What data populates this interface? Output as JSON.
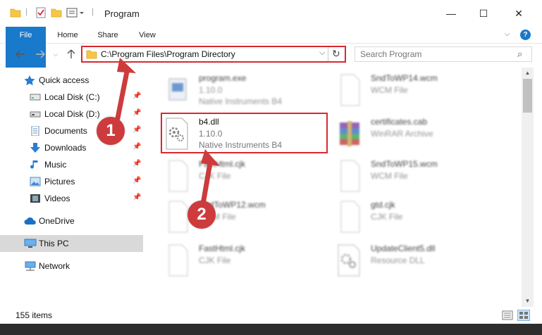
{
  "window": {
    "title": "Program",
    "controls": {
      "minimize": "—",
      "maximize": "☐",
      "close": "✕"
    }
  },
  "ribbon": {
    "tabs": [
      "File",
      "Home",
      "Share",
      "View"
    ],
    "help": "?"
  },
  "address": {
    "path": "C:\\Program Files\\Program Directory"
  },
  "search": {
    "placeholder": "Search Program"
  },
  "nav": {
    "quick_access": "Quick access",
    "items": [
      {
        "label": "Local Disk (C:)",
        "icon": "drive-icon"
      },
      {
        "label": "Local Disk (D:)",
        "icon": "drive-icon"
      },
      {
        "label": "Documents",
        "icon": "documents-icon"
      },
      {
        "label": "Downloads",
        "icon": "downloads-icon"
      },
      {
        "label": "Music",
        "icon": "music-icon"
      },
      {
        "label": "Pictures",
        "icon": "pictures-icon"
      },
      {
        "label": "Videos",
        "icon": "videos-icon"
      }
    ],
    "onedrive": "OneDrive",
    "this_pc": "This PC",
    "network": "Network"
  },
  "files": [
    {
      "name": "program.exe",
      "line2": "1.10.0",
      "line3": "Native Instruments B4",
      "icon": "exe-icon"
    },
    {
      "name": "SndToWP14.wcm",
      "line2": "WCM File",
      "line3": "",
      "icon": "blank-file-icon"
    },
    {
      "name": "b4.dll",
      "line2": "1.10.0",
      "line3": "Native Instruments B4",
      "icon": "dll-gear-icon"
    },
    {
      "name": "certificates.cab",
      "line2": "WinRAR Archive",
      "line3": "",
      "icon": "winrar-icon"
    },
    {
      "name": "FastHtml.cjk",
      "line2": "CJK File",
      "line3": "",
      "icon": "blank-file-icon"
    },
    {
      "name": "SndToWP15.wcm",
      "line2": "WCM File",
      "line3": "",
      "icon": "blank-file-icon"
    },
    {
      "name": "SndToWP12.wcm",
      "line2": "WCM File",
      "line3": "",
      "icon": "blank-file-icon"
    },
    {
      "name": "gtd.cjk",
      "line2": "CJK File",
      "line3": "",
      "icon": "blank-file-icon"
    },
    {
      "name": "FastHtml.cjk",
      "line2": "CJK File",
      "line3": "",
      "icon": "blank-file-icon"
    },
    {
      "name": "UpdateClient5.dll",
      "line2": "Resource DLL",
      "line3": "",
      "icon": "dll-gear-icon"
    }
  ],
  "status": {
    "item_count": "155 items"
  },
  "annotations": {
    "step1": "1",
    "step2": "2",
    "color": "#cd3b3c"
  },
  "colors": {
    "accent": "#1979ca",
    "highlight_border": "#d9292f",
    "folder": "#f7c744"
  }
}
